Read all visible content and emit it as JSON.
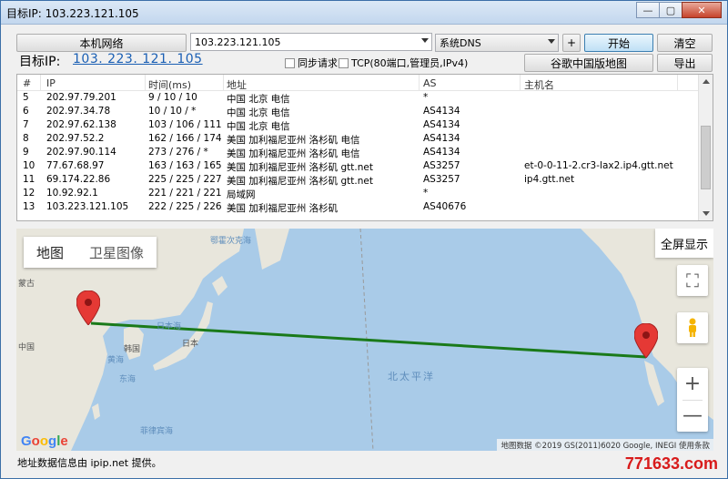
{
  "window": {
    "title": "目标IP: 103.223.121.105",
    "btn_min": "—",
    "btn_max": "▢",
    "btn_close": "✕"
  },
  "toolbar": {
    "local_network_btn": "本机网络",
    "ip_input_value": "103.223.121.105",
    "dns_select": "系统DNS",
    "plus_btn": "+",
    "start_btn": "开始",
    "clear_btn": "清空",
    "target_label": "目标IP:",
    "target_ip": "103. 223. 121. 105",
    "sync_request": "同步请求",
    "tcp_option": "TCP(80端口,管理员,IPv4)",
    "google_cn_map_btn": "谷歌中国版地图",
    "export_btn": "导出"
  },
  "table": {
    "headers": [
      "#",
      "IP",
      "时间(ms)",
      "地址",
      "AS",
      "主机名"
    ],
    "rows": [
      [
        "5",
        "202.97.79.201",
        "9 / 10 / 10",
        "中国 北京 电信",
        "*",
        ""
      ],
      [
        "6",
        "202.97.34.78",
        "10 / 10 / *",
        "中国 北京 电信",
        "AS4134",
        ""
      ],
      [
        "7",
        "202.97.62.138",
        "103 / 106 / 111",
        "中国 北京 电信",
        "AS4134",
        ""
      ],
      [
        "8",
        "202.97.52.2",
        "162 / 166 / 174",
        "美国 加利福尼亚州 洛杉矶 电信",
        "AS4134",
        ""
      ],
      [
        "9",
        "202.97.90.114",
        "273 / 276 / *",
        "美国 加利福尼亚州 洛杉矶 电信",
        "AS4134",
        ""
      ],
      [
        "10",
        "77.67.68.97",
        "163 / 163 / 165",
        "美国 加利福尼亚州 洛杉矶 gtt.net",
        "AS3257",
        "et-0-0-11-2.cr3-lax2.ip4.gtt.net"
      ],
      [
        "11",
        "69.174.22.86",
        "225 / 225 / 227",
        "美国 加利福尼亚州 洛杉矶 gtt.net",
        "AS3257",
        "ip4.gtt.net"
      ],
      [
        "12",
        "10.92.92.1",
        "221 / 221 / 221",
        "局域网",
        "*",
        ""
      ],
      [
        "13",
        "103.223.121.105",
        "222 / 225 / 226",
        "美国 加利福尼亚州 洛杉矶",
        "AS40676",
        ""
      ]
    ]
  },
  "map": {
    "tab_map": "地图",
    "tab_satellite": "卫星图像",
    "fullscreen_label": "全屏显示",
    "zoom_in": "+",
    "zoom_out": "—",
    "labels": {
      "mongolia": "蒙古",
      "china": "中国",
      "korea": "韩国",
      "japan": "日本",
      "sea_of_japan": "日本海",
      "yellow_sea": "黄海",
      "east_china_sea": "东海",
      "okhotsk": "鄂霍次克海",
      "philippine_sea": "菲律宾海",
      "north_pacific": "北太平洋"
    },
    "attribution": "地图数据 ©2019 GS(2011)6020 Google, INEGI   使用条款",
    "google_logo": "Google",
    "line_color": "#1a7a1a"
  },
  "status": {
    "text": "地址数据信息由 ipip.net 提供。"
  },
  "watermark": "771633.com"
}
